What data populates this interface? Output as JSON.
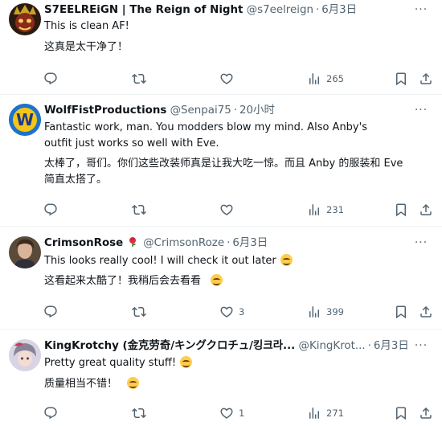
{
  "replies": [
    {
      "display_name": "S7EELREiGN | The Reign of Night",
      "handle": "@s7eelreign",
      "time": "6月3日",
      "text_en": "This is clean AF!",
      "text_zh": "这真是太干净了！",
      "replies_count": "",
      "retweets_count": "",
      "likes_count": "",
      "views_count": "265",
      "avatar_icon": "skull-face-avatar",
      "avatar_color": "#8b2a1a"
    },
    {
      "display_name": "WolfFistProductions",
      "handle": "@Senpai75",
      "time": "20小时",
      "avatar_letter": "W",
      "text_en": "Fantastic work, man. You modders blow my mind. Also Anby's outfit just works so well with Eve.",
      "text_zh_1": "太棒了，哥们。你们这些改装师真是让我大吃一惊。而且 Anby 的服装和 Eve",
      "text_zh_2": "简直太搭了。",
      "replies_count": "",
      "retweets_count": "",
      "likes_count": "",
      "views_count": "231",
      "avatar_color": "#1e73c8"
    },
    {
      "display_name": "CrimsonRose",
      "handle": "@CrimsonRoze",
      "time": "6月3日",
      "text_en": "This looks really cool! I will check it out later",
      "text_zh": "这看起来太酷了！我稍后会去看看",
      "replies_count": "",
      "retweets_count": "",
      "likes_count": "3",
      "views_count": "399",
      "badge_icon": "rose-icon",
      "avatar_icon": "portrait-avatar"
    },
    {
      "display_name": "KingKrotchy (金克劳奇/キングクロチュ/킹크라...",
      "handle": "@KingKrot...",
      "time": "6月3日",
      "text_en": "Pretty great quality stuff!",
      "text_zh": "质量相当不错！",
      "replies_count": "",
      "retweets_count": "",
      "likes_count": "1",
      "views_count": "271",
      "avatar_icon": "anime-character-avatar"
    }
  ],
  "separator": "·",
  "more_label": "···",
  "colors": {
    "text": "#0f1419",
    "secondary": "#536471",
    "divider": "#eff3f4"
  }
}
